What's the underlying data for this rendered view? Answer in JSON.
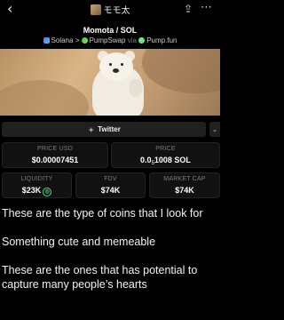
{
  "header": {
    "back_icon": "chevron-left-icon",
    "title": "モモ太",
    "share_icon": "share-icon",
    "more_icon": "more-icon"
  },
  "token": {
    "pair": "Momota / SOL",
    "chain": "Solana",
    "dex": "PumpSwap",
    "via_label": "via",
    "launchpad": "Pump.fun"
  },
  "socials": {
    "twitter_label": "Twitter",
    "more_label": "⌄"
  },
  "stats": {
    "price_usd_label": "PRICE USD",
    "price_usd": "$0.00007451",
    "price_label": "PRICE",
    "price_prefix": "0.0",
    "price_zeros": "5",
    "price_suffix": "1008 SOL",
    "liquidity_label": "LIQUIDITY",
    "liquidity": "$23K",
    "fdv_label": "FDV",
    "fdv": "$74K",
    "mcap_label": "MARKET CAP",
    "mcap": "$74K"
  },
  "post": {
    "line1": "These are the type of coins that I look for",
    "line2": "Something cute and memeable",
    "line3": "These are the ones that has potential to capture many people’s hearts"
  },
  "colors": {
    "background": "#000000",
    "card": "#111111",
    "accent_green": "#4ade80"
  }
}
